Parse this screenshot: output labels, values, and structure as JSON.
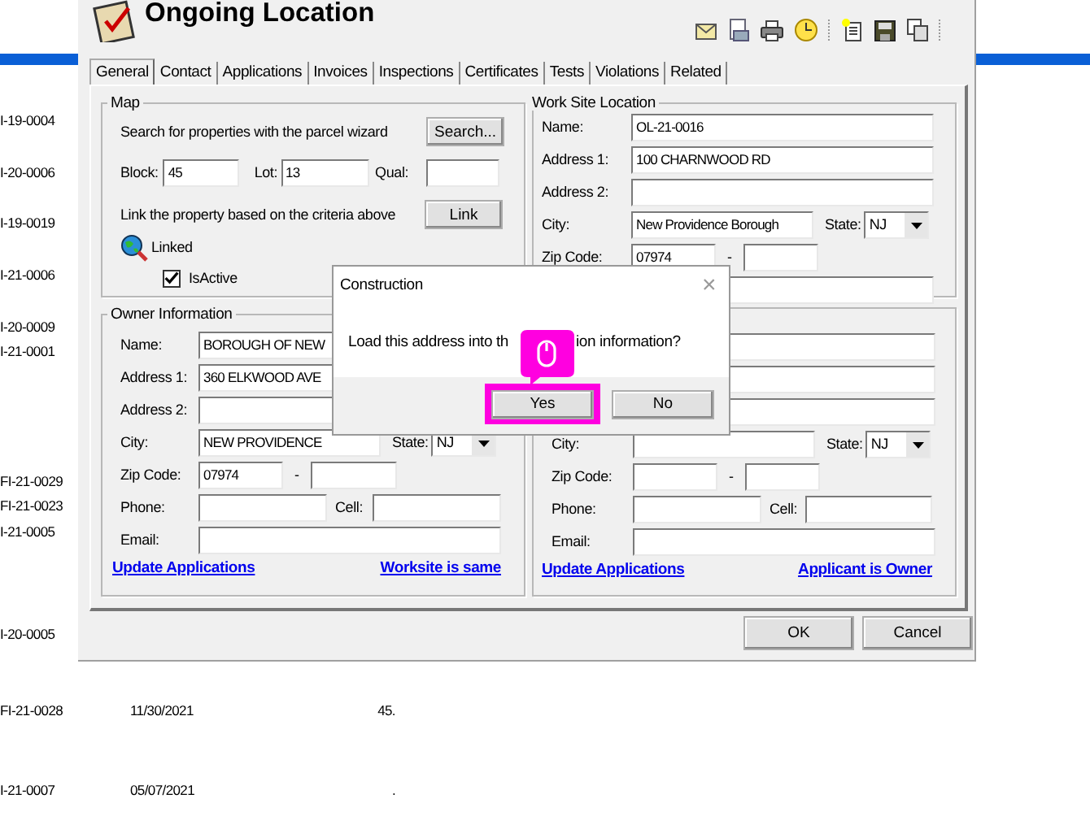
{
  "report_rows": [
    {
      "id": "I-19-0004"
    },
    {
      "id": "I-20-0006"
    },
    {
      "id": "I-19-0019"
    },
    {
      "id": "I-21-0006"
    },
    {
      "id": "I-20-0009"
    },
    {
      "id": "I-21-0001"
    },
    {
      "id": "FI-21-0029"
    },
    {
      "id": "FI-21-0023"
    },
    {
      "id": "I-21-0005"
    },
    {
      "id": "I-20-0005"
    },
    {
      "id": "FI-21-0028",
      "date": "11/30/2021",
      "amount": "45."
    },
    {
      "id": "I-21-0007",
      "date": "05/07/2021",
      "amount": "."
    }
  ],
  "window": {
    "title": "Ongoing Location"
  },
  "tabs": [
    {
      "label": "General",
      "selected": true
    },
    {
      "label": "Contact",
      "selected": false
    },
    {
      "label": "Applications",
      "selected": false
    },
    {
      "label": "Invoices",
      "selected": false
    },
    {
      "label": "Inspections",
      "selected": false
    },
    {
      "label": "Certificates",
      "selected": false
    },
    {
      "label": "Tests",
      "selected": false
    },
    {
      "label": "Violations",
      "selected": false
    },
    {
      "label": "Related",
      "selected": false
    }
  ],
  "map": {
    "title": "Map",
    "search_text": "Search for properties with the parcel wizard",
    "search_button": "Search...",
    "block_label": "Block:",
    "block_value": "45",
    "lot_label": "Lot:",
    "lot_value": "13",
    "qual_label": "Qual:",
    "link_text": "Link the property based on the criteria above",
    "link_button": "Link",
    "linked_label": "Linked",
    "isactive": {
      "label": "IsActive",
      "checked": true
    }
  },
  "owner": {
    "title": "Owner Information",
    "rows": [
      {
        "kind": "text",
        "label": "Name:",
        "value": "BOROUGH OF NEW"
      },
      {
        "kind": "text",
        "label": "Address 1:",
        "value": "360 ELKWOOD AVE"
      },
      {
        "kind": "text",
        "label": "Address 2:"
      },
      {
        "kind": "city",
        "label": "City:",
        "value": "NEW PROVIDENCE",
        "state_label": "State:",
        "state": "NJ"
      },
      {
        "kind": "zip",
        "label": "Zip Code:",
        "value": "07974",
        "separator": "-"
      },
      {
        "kind": "phone",
        "label": "Phone:",
        "cell_label": "Cell:"
      },
      {
        "kind": "text",
        "label": "Email:"
      }
    ],
    "links": [
      "Update Applications",
      "Worksite is same"
    ]
  },
  "worksite": {
    "title": "Work Site Location",
    "rows": [
      {
        "kind": "text",
        "label": "Name:",
        "value": "OL-21-0016"
      },
      {
        "kind": "text",
        "label": "Address 1:",
        "value": "100 CHARNWOOD RD"
      },
      {
        "kind": "text",
        "label": "Address 2:"
      },
      {
        "kind": "city",
        "label": "City:",
        "value": "New Providence Borough",
        "state_label": "State:",
        "state": "NJ"
      },
      {
        "kind": "zip",
        "label": "Zip Code:",
        "value": "07974",
        "separator": "-"
      },
      {
        "kind": "text"
      }
    ]
  },
  "applicant": {
    "rows": [
      {
        "kind": "text"
      },
      {
        "kind": "text"
      },
      {
        "kind": "text"
      },
      {
        "kind": "city",
        "label": "City:",
        "state_label": "State:",
        "state": "NJ"
      },
      {
        "kind": "zip",
        "label": "Zip Code:",
        "separator": "-"
      },
      {
        "kind": "phone",
        "label": "Phone:",
        "cell_label": "Cell:"
      },
      {
        "kind": "text",
        "label": "Email:"
      }
    ],
    "links": [
      "Update Applications",
      "Applicant is Owner"
    ]
  },
  "buttons": [
    "OK",
    "Cancel"
  ],
  "dialog": {
    "title": "Construction",
    "close": "×",
    "message_start": "Load this address into th",
    "message_end": "ion information?",
    "buttons": [
      {
        "label": "Yes",
        "highlighted": true
      },
      {
        "label": "No",
        "highlighted": false
      }
    ]
  }
}
